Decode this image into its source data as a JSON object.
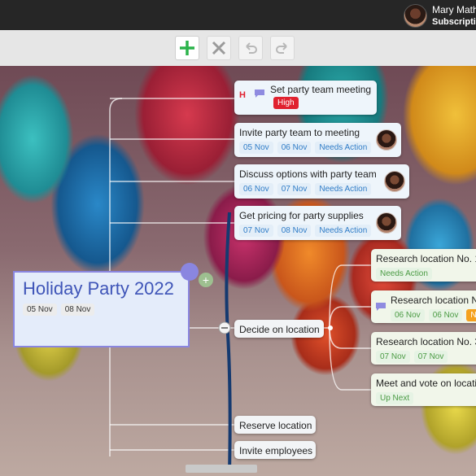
{
  "user": {
    "name": "Mary Math",
    "subscription": "Subscriptio"
  },
  "toolbar": {
    "add": "add-icon",
    "delete": "close-icon",
    "undo": "undo-icon",
    "redo": "redo-icon"
  },
  "root": {
    "title": "Holiday Party 2022",
    "chips": [
      "05 Nov",
      "08 Nov"
    ]
  },
  "tasks": [
    {
      "title": "Set party team meeting",
      "priority_letter": "H",
      "priority": "High"
    },
    {
      "title": "Invite party team to meeting",
      "chips": [
        "05 Nov",
        "06 Nov",
        "Needs Action"
      ]
    },
    {
      "title": "Discuss options with party team",
      "chips": [
        "06 Nov",
        "07 Nov",
        "Needs Action"
      ]
    },
    {
      "title": "Get pricing for party supplies",
      "chips": [
        "07 Nov",
        "08 Nov",
        "Needs Action"
      ]
    }
  ],
  "decide": {
    "title": "Decide on location"
  },
  "locations": [
    {
      "title": "Research location No. 1",
      "chips": [
        "Needs Action"
      ]
    },
    {
      "title": "Research location No",
      "chips": [
        "06 Nov",
        "06 Nov",
        "N"
      ]
    },
    {
      "title": "Research location No. 3",
      "chips": [
        "07 Nov",
        "07 Nov"
      ]
    },
    {
      "title": "Meet and vote on locati",
      "chips": [
        "Up Next"
      ]
    }
  ],
  "bottom": {
    "reserve": "Reserve location",
    "invite": "Invite employees"
  },
  "colors": {
    "accent": "#2f7cc7",
    "green": "#4b9b44",
    "high": "#e0212f",
    "root_border": "#8a86e0"
  }
}
